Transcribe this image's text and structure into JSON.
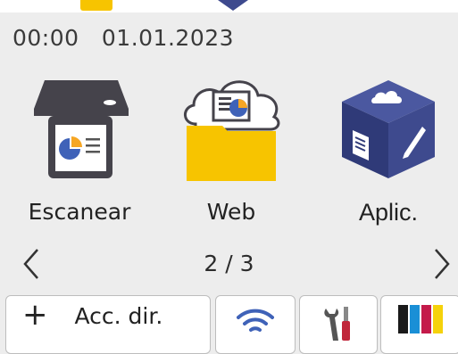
{
  "status": {
    "time": "00:00",
    "date": "01.01.2023"
  },
  "tiles": [
    {
      "label": "Escanear",
      "icon": "scanner-icon"
    },
    {
      "label": "Web",
      "icon": "web-folder-icon"
    },
    {
      "label": "Aplic.",
      "icon": "apps-cube-icon"
    }
  ],
  "pager": {
    "current": "2",
    "total": "3",
    "text": "2 / 3"
  },
  "bottom_bar": {
    "shortcut_label": "Acc. dir.",
    "shortcut_icon": "plus-icon",
    "wifi_icon": "wifi-icon",
    "settings_icon": "tools-icon",
    "ink_icon": "ink-cartridges-icon"
  },
  "colors": {
    "background": "#ededed",
    "folder_yellow": "#f7c400",
    "apps_blue": "#3e4a8e",
    "ink_black": "#1a1a1a",
    "ink_cyan": "#1a8fd6",
    "ink_magenta": "#c41a4a",
    "ink_yellow": "#f5d20b"
  }
}
